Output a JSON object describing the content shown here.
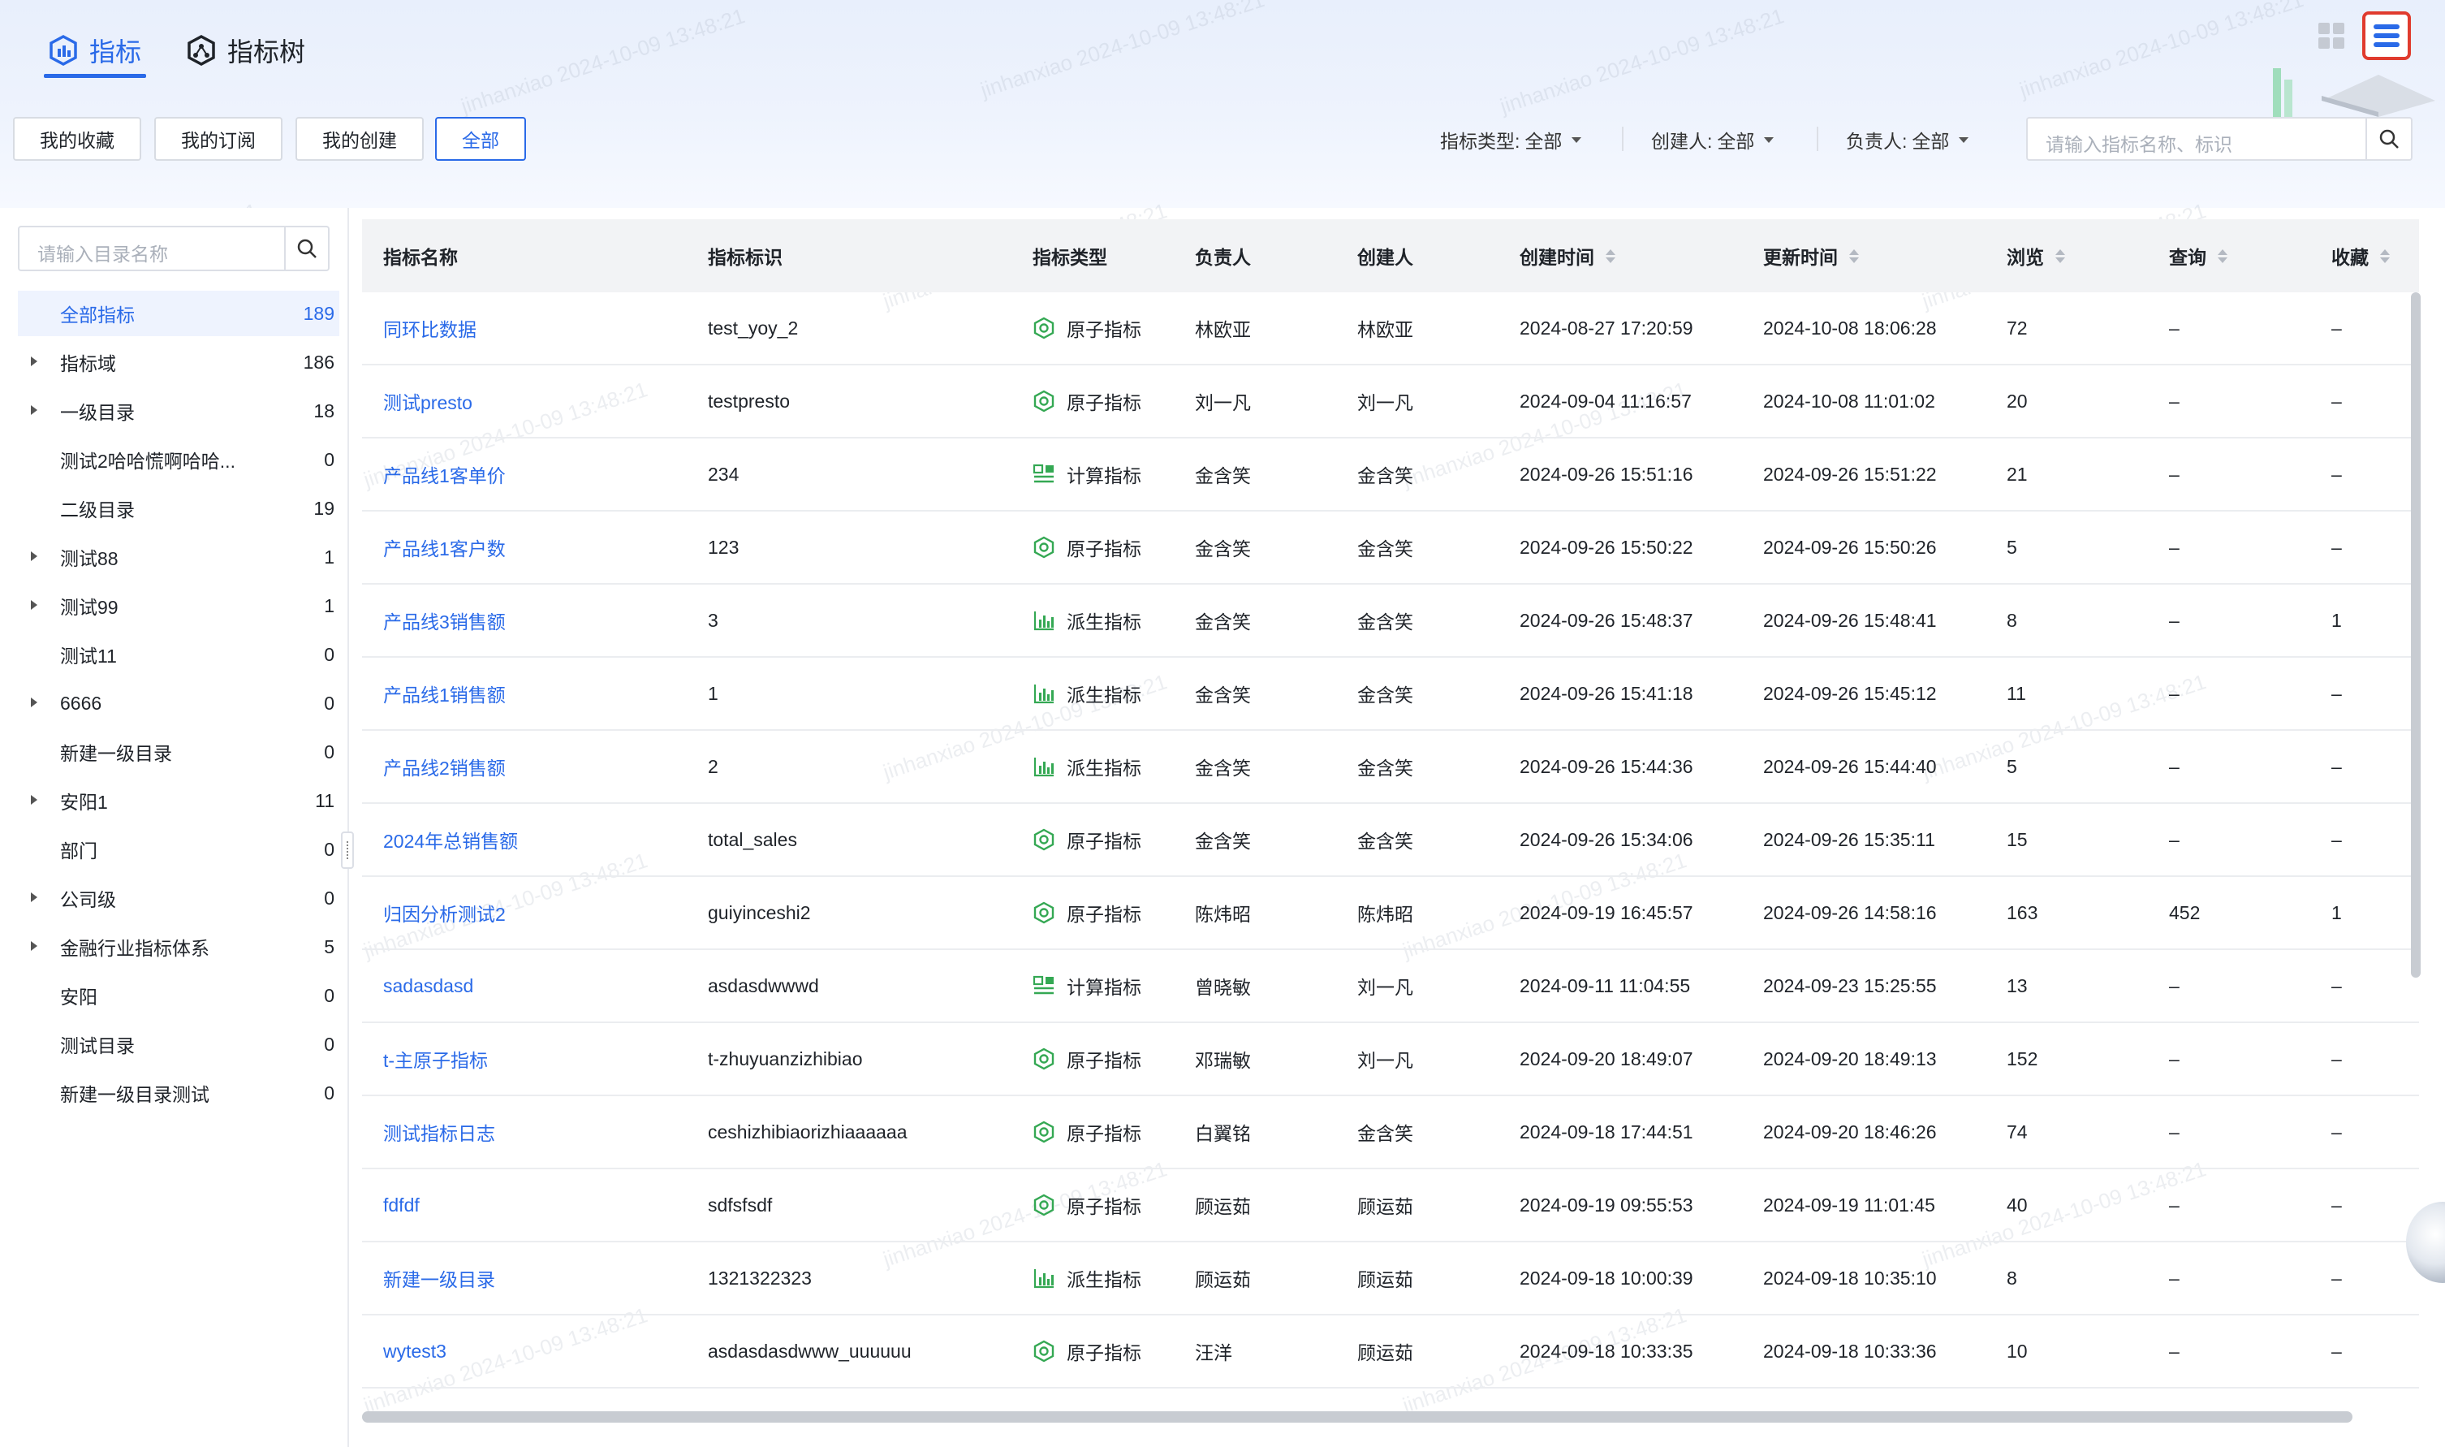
{
  "tabs": [
    {
      "label": "指标",
      "active": true,
      "icon": "metric-icon"
    },
    {
      "label": "指标树",
      "active": false,
      "icon": "metric-tree-icon"
    }
  ],
  "view_switch": {
    "grid_icon": "grid-view-icon",
    "list_icon": "list-view-icon",
    "active": "list"
  },
  "filter_buttons": [
    {
      "label": "我的收藏",
      "active": false
    },
    {
      "label": "我的订阅",
      "active": false
    },
    {
      "label": "我的创建",
      "active": false
    },
    {
      "label": "全部",
      "active": true
    }
  ],
  "filters": {
    "type": {
      "label": "指标类型:",
      "value": "全部"
    },
    "creator": {
      "label": "创建人:",
      "value": "全部"
    },
    "owner": {
      "label": "负责人:",
      "value": "全部"
    }
  },
  "search": {
    "placeholder": "请输入指标名称、标识"
  },
  "sidebar": {
    "search_placeholder": "请输入目录名称",
    "items": [
      {
        "label": "全部指标",
        "count": "189",
        "expandable": false,
        "active": true
      },
      {
        "label": "指标域",
        "count": "186",
        "expandable": true
      },
      {
        "label": "一级目录",
        "count": "18",
        "expandable": true
      },
      {
        "label": "测试2哈哈慌啊哈哈...",
        "count": "0",
        "expandable": false
      },
      {
        "label": "二级目录",
        "count": "19",
        "expandable": false
      },
      {
        "label": "测试88",
        "count": "1",
        "expandable": true
      },
      {
        "label": "测试99",
        "count": "1",
        "expandable": true
      },
      {
        "label": "测试11",
        "count": "0",
        "expandable": false
      },
      {
        "label": "6666",
        "count": "0",
        "expandable": true
      },
      {
        "label": "新建一级目录",
        "count": "0",
        "expandable": false
      },
      {
        "label": "安阳1",
        "count": "11",
        "expandable": true
      },
      {
        "label": "部门",
        "count": "0",
        "expandable": false
      },
      {
        "label": "公司级",
        "count": "0",
        "expandable": true
      },
      {
        "label": "金融行业指标体系",
        "count": "5",
        "expandable": true
      },
      {
        "label": "安阳",
        "count": "0",
        "expandable": false
      },
      {
        "label": "测试目录",
        "count": "0",
        "expandable": false
      },
      {
        "label": "新建一级目录测试",
        "count": "0",
        "expandable": false
      }
    ]
  },
  "table": {
    "columns": [
      "指标名称",
      "指标标识",
      "指标类型",
      "负责人",
      "创建人",
      "创建时间",
      "更新时间",
      "浏览",
      "查询",
      "收藏"
    ],
    "rows": [
      {
        "name": "同环比数据",
        "id": "test_yoy_2",
        "type": "原子指标",
        "type_icon": "atomic-metric-icon",
        "owner": "林欧亚",
        "creator": "林欧亚",
        "created": "2024-08-27 17:20:59",
        "updated": "2024-10-08 18:06:28",
        "views": "72",
        "queries": "–",
        "favs": "–"
      },
      {
        "name": "测试presto",
        "id": "testpresto",
        "type": "原子指标",
        "type_icon": "atomic-metric-icon",
        "owner": "刘一凡",
        "creator": "刘一凡",
        "created": "2024-09-04 11:16:57",
        "updated": "2024-10-08 11:01:02",
        "views": "20",
        "queries": "–",
        "favs": "–"
      },
      {
        "name": "产品线1客单价",
        "id": "234",
        "type": "计算指标",
        "type_icon": "calculated-metric-icon",
        "owner": "金含笑",
        "creator": "金含笑",
        "created": "2024-09-26 15:51:16",
        "updated": "2024-09-26 15:51:22",
        "views": "21",
        "queries": "–",
        "favs": "–"
      },
      {
        "name": "产品线1客户数",
        "id": "123",
        "type": "原子指标",
        "type_icon": "atomic-metric-icon",
        "owner": "金含笑",
        "creator": "金含笑",
        "created": "2024-09-26 15:50:22",
        "updated": "2024-09-26 15:50:26",
        "views": "5",
        "queries": "–",
        "favs": "–"
      },
      {
        "name": "产品线3销售额",
        "id": "3",
        "type": "派生指标",
        "type_icon": "derived-metric-icon",
        "owner": "金含笑",
        "creator": "金含笑",
        "created": "2024-09-26 15:48:37",
        "updated": "2024-09-26 15:48:41",
        "views": "8",
        "queries": "–",
        "favs": "1"
      },
      {
        "name": "产品线1销售额",
        "id": "1",
        "type": "派生指标",
        "type_icon": "derived-metric-icon",
        "owner": "金含笑",
        "creator": "金含笑",
        "created": "2024-09-26 15:41:18",
        "updated": "2024-09-26 15:45:12",
        "views": "11",
        "queries": "–",
        "favs": "–"
      },
      {
        "name": "产品线2销售额",
        "id": "2",
        "type": "派生指标",
        "type_icon": "derived-metric-icon",
        "owner": "金含笑",
        "creator": "金含笑",
        "created": "2024-09-26 15:44:36",
        "updated": "2024-09-26 15:44:40",
        "views": "5",
        "queries": "–",
        "favs": "–"
      },
      {
        "name": "2024年总销售额",
        "id": "total_sales",
        "type": "原子指标",
        "type_icon": "atomic-metric-icon",
        "owner": "金含笑",
        "creator": "金含笑",
        "created": "2024-09-26 15:34:06",
        "updated": "2024-09-26 15:35:11",
        "views": "15",
        "queries": "–",
        "favs": "–"
      },
      {
        "name": "归因分析测试2",
        "id": "guiyinceshi2",
        "type": "原子指标",
        "type_icon": "atomic-metric-icon",
        "owner": "陈炜昭",
        "creator": "陈炜昭",
        "created": "2024-09-19 16:45:57",
        "updated": "2024-09-26 14:58:16",
        "views": "163",
        "queries": "452",
        "favs": "1"
      },
      {
        "name": "sadasdasd",
        "id": "asdasdwwwd",
        "type": "计算指标",
        "type_icon": "calculated-metric-icon",
        "owner": "曾晓敏",
        "creator": "刘一凡",
        "created": "2024-09-11 11:04:55",
        "updated": "2024-09-23 15:25:55",
        "views": "13",
        "queries": "–",
        "favs": "–"
      },
      {
        "name": "t-主原子指标",
        "id": "t-zhuyuanzizhibiao",
        "type": "原子指标",
        "type_icon": "atomic-metric-icon",
        "owner": "邓瑞敏",
        "creator": "刘一凡",
        "created": "2024-09-20 18:49:07",
        "updated": "2024-09-20 18:49:13",
        "views": "152",
        "queries": "–",
        "favs": "–"
      },
      {
        "name": "测试指标日志",
        "id": "ceshizhibiaorizhiaaaaaa",
        "type": "原子指标",
        "type_icon": "atomic-metric-icon",
        "owner": "白翼铭",
        "creator": "金含笑",
        "created": "2024-09-18 17:44:51",
        "updated": "2024-09-20 18:46:26",
        "views": "74",
        "queries": "–",
        "favs": "–"
      },
      {
        "name": "fdfdf",
        "id": "sdfsfsdf",
        "type": "原子指标",
        "type_icon": "atomic-metric-icon",
        "owner": "顾运茹",
        "creator": "顾运茹",
        "created": "2024-09-19 09:55:53",
        "updated": "2024-09-19 11:01:45",
        "views": "40",
        "queries": "–",
        "favs": "–"
      },
      {
        "name": "新建一级目录",
        "id": "1321322323",
        "type": "派生指标",
        "type_icon": "derived-metric-icon",
        "owner": "顾运茹",
        "creator": "顾运茹",
        "created": "2024-09-18 10:00:39",
        "updated": "2024-09-18 10:35:10",
        "views": "8",
        "queries": "–",
        "favs": "–"
      },
      {
        "name": "wytest3",
        "id": "asdasdasdwww_uuuuuu",
        "type": "原子指标",
        "type_icon": "atomic-metric-icon",
        "owner": "汪洋",
        "creator": "顾运茹",
        "created": "2024-09-18 10:33:35",
        "updated": "2024-09-18 10:33:36",
        "views": "10",
        "queries": "–",
        "favs": "–"
      }
    ]
  },
  "watermark": "jinhanxiao 2024-10-09 13:48:21",
  "colors": {
    "accent": "#2a6ae8",
    "icon_green": "#34a853"
  }
}
